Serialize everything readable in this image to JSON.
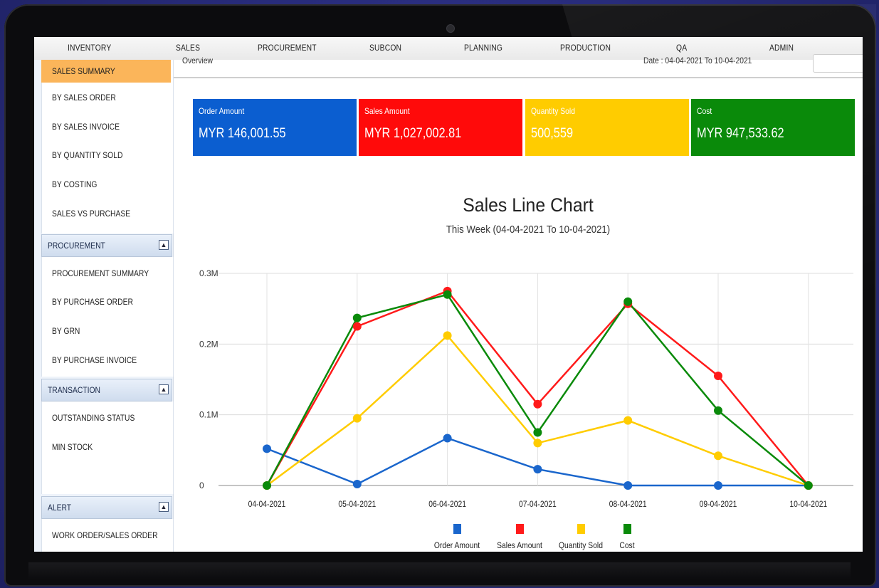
{
  "topnav": {
    "items": [
      "INVENTORY",
      "SALES",
      "PROCUREMENT",
      "SUBCON",
      "PLANNING",
      "PRODUCTION",
      "QA",
      "ADMIN"
    ]
  },
  "sidebar": {
    "sales_items": [
      "SALES SUMMARY",
      "BY SALES ORDER",
      "BY SALES INVOICE",
      "BY QUANTITY SOLD",
      "BY COSTING",
      "SALES VS PURCHASE"
    ],
    "procurement": {
      "title": "PROCUREMENT",
      "items": [
        "PROCUREMENT SUMMARY",
        "BY PURCHASE ORDER",
        "BY GRN",
        "BY PURCHASE INVOICE"
      ]
    },
    "transaction": {
      "title": "TRANSACTION",
      "items": [
        "OUTSTANDING STATUS",
        "MIN STOCK"
      ]
    },
    "alert": {
      "title": "ALERT",
      "items": [
        "WORK ORDER/SALES ORDER"
      ]
    },
    "collapse_icon": "chevron-up-icon"
  },
  "overview": {
    "title": "Overview",
    "date": "Date : 04-04-2021 To 10-04-2021"
  },
  "cards": [
    {
      "label": "Order Amount",
      "value": "MYR 146,001.55",
      "color": "#0b5ed0"
    },
    {
      "label": "Sales Amount",
      "value": "MYR 1,027,002.81",
      "color": "#ff0a0a"
    },
    {
      "label": "Quantity Sold",
      "value": "500,559",
      "color": "#ffcc00"
    },
    {
      "label": "Cost",
      "value": "MYR 947,533.62",
      "color": "#0a8a0a"
    }
  ],
  "chart_data": {
    "type": "line",
    "title": "Sales Line Chart",
    "subtitle": "This Week (04-04-2021 To 10-04-2021)",
    "categories": [
      "04-04-2021",
      "05-04-2021",
      "06-04-2021",
      "07-04-2021",
      "08-04-2021",
      "09-04-2021",
      "10-04-2021"
    ],
    "y_ticks": [
      "0",
      "0.1M",
      "0.2M",
      "0.3M"
    ],
    "ylim": [
      0,
      300000
    ],
    "grid": true,
    "legend_position": "bottom",
    "series": [
      {
        "name": "Order Amount",
        "color": "#1a66cc",
        "values": [
          52000,
          2000,
          67000,
          23000,
          0,
          0,
          0
        ]
      },
      {
        "name": "Sales Amount",
        "color": "#ff1a1a",
        "values": [
          0,
          225000,
          275000,
          115000,
          257000,
          155000,
          0
        ]
      },
      {
        "name": "Quantity Sold",
        "color": "#ffcc00",
        "values": [
          0,
          95000,
          212000,
          60000,
          92000,
          42000,
          0
        ]
      },
      {
        "name": "Cost",
        "color": "#0a8a0a",
        "values": [
          0,
          237000,
          270000,
          75000,
          260000,
          106000,
          0
        ]
      }
    ]
  }
}
